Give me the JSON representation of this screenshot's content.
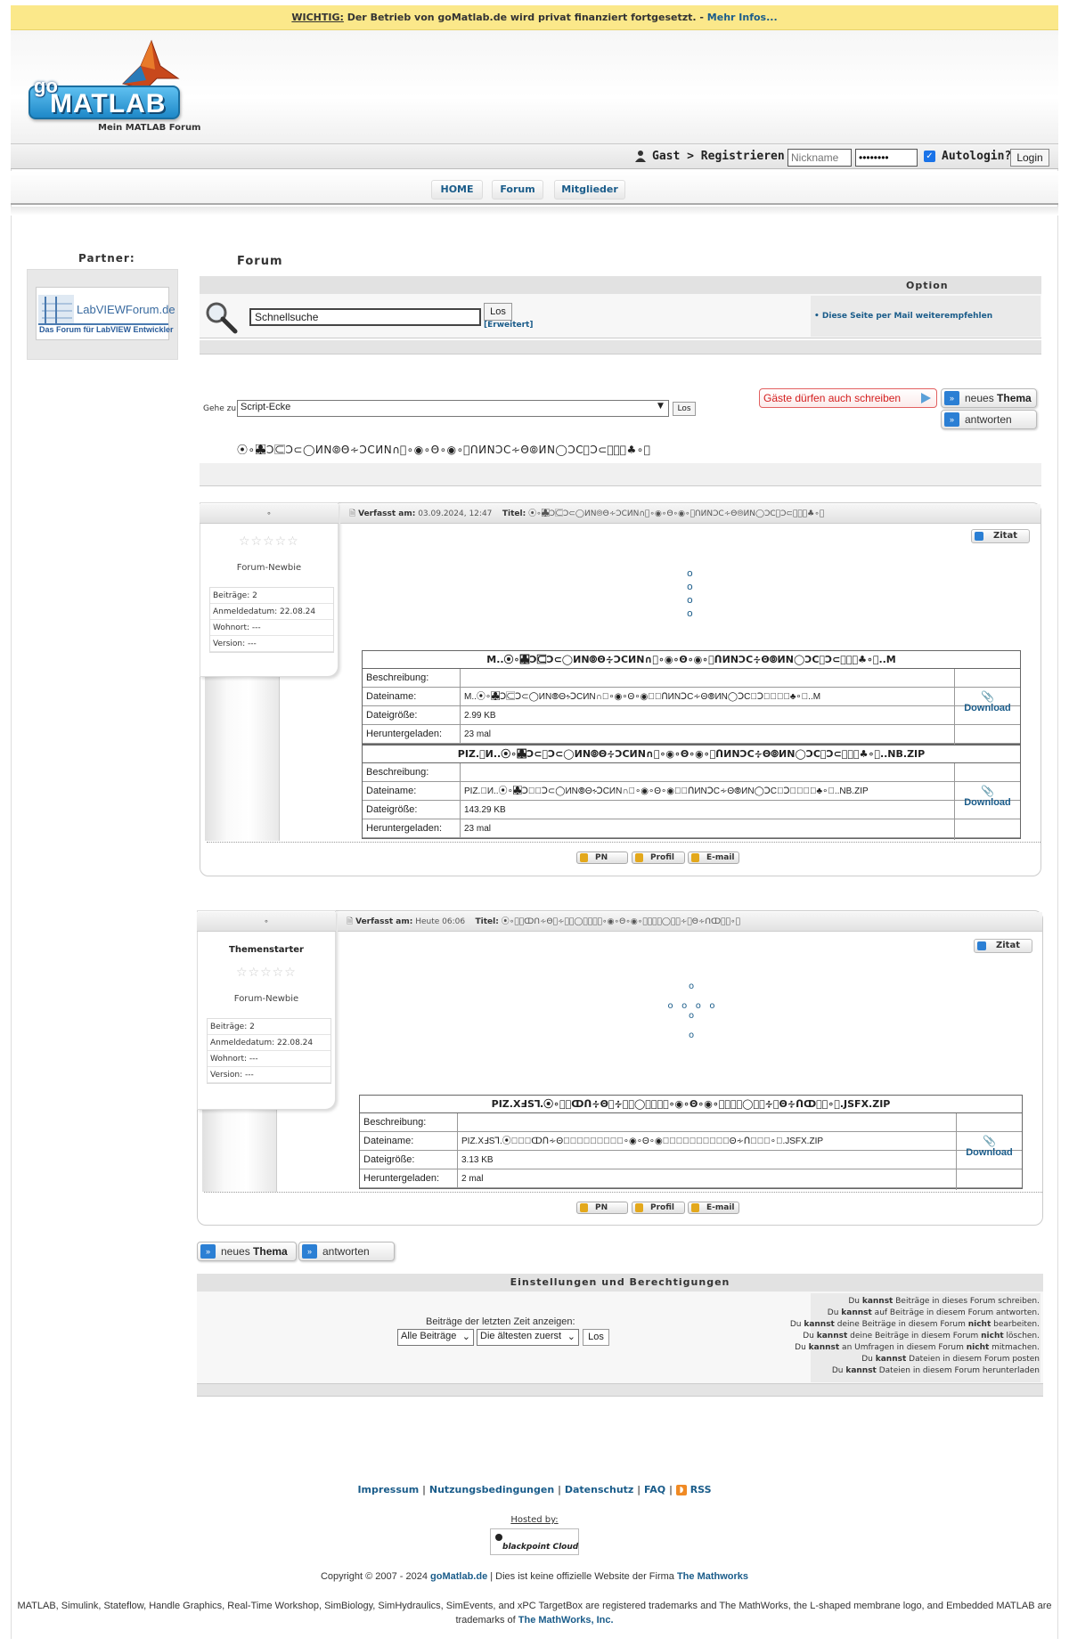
{
  "notice": {
    "prefix": "WICHTIG:",
    "text": " Der Betrieb von goMatlab.de wird privat finanziert fortgesetzt. - ",
    "link": "Mehr Infos..."
  },
  "logo": {
    "go": "go",
    "matlab": "MATLAB",
    "subtitle": "Mein MATLAB Forum"
  },
  "login": {
    "guest_text": "Gast > Registrieren",
    "nickname_placeholder": "Nickname",
    "password_value": "••••••••",
    "autologin_label": "Autologin?",
    "login_button": "Login"
  },
  "nav": {
    "home": "HOME",
    "forum": "Forum",
    "members": "Mitglieder"
  },
  "sidebar": {
    "partner_title": "Partner:",
    "partner_name": "LabVIEWForum.de",
    "partner_tagline": "Das Forum für LabVIEW Entwickler"
  },
  "forum": {
    "title": "Forum",
    "option_header": "Option",
    "search_value": "Schnellsuche",
    "search_button": "Los",
    "extended_search": "[Erweitert]",
    "mail_link": "• Diese Seite per Mail weiterempfehlen"
  },
  "jump": {
    "label": "Gehe zu:",
    "selected": "Script-Ecke",
    "button": "Los"
  },
  "actions": {
    "guests_write": "Gäste dürfen auch schreiben",
    "new_topic_prefix": "neues ",
    "new_topic_bold": "Thema",
    "reply": "antworten"
  },
  "topic_title": "⦿∘♣⃞⃞⃞Ↄ⊂⃞Ↄ⊂◯ИΝ⦾Θ∻ↃϹИΝ∩⃞∘◉∘Θ∘◉∘⃞ᑎИΝↃϹ∻Θ⦾ИΝ◯ↃϹ⃞Ↄ⊂⃞⃞⃞♣∘⦿",
  "posts": [
    {
      "author": "∘",
      "author_label": "",
      "stars": "☆☆☆☆☆",
      "rank": "Forum-Newbie",
      "info": [
        "Beiträge: 2",
        "Anmeldedatum: 22.08.24",
        "Wohnort: ---",
        "Version: ---"
      ],
      "posted_label": "Verfasst am:",
      "posted_date": "03.09.2024, 12:47",
      "title_label": "Titel:",
      "title": "⦿∘♣⃞⃞⃞Ↄ⊂⃞Ↄ⊂◯ИΝ⦾Θ∻ↃϹИΝ∩⃞∘◉∘Θ∘◉∘⃞ᑎИΝↃϹ∻Θ⦾ИΝ◯ↃϹ⃞Ↄ⊂⃞⃞⃞♣∘⦿",
      "quote": "Zitat",
      "attachments": [
        {
          "header": "M..⦿∘♣⃞⃞⃞Ↄ⊂⃞Ↄ⊂◯ИΝ⦾Θ∻ↃϹИΝ∩⃞∘◉∘Θ∘◉∘⃞ᑎИΝↃϹ∻Θ⦾ИΝ◯ↃϹ⃞Ↄ⊂⃞⃞⃞♣∘⦿..M",
          "labels": [
            "Beschreibung:",
            "Dateiname:",
            "Dateigröße:",
            "Heruntergeladen:"
          ],
          "description": "",
          "filename": "M..⦿∘♣⃞⃞⃞Ↄ⊂⃞Ↄ⊂◯ИΝ⦾Θ∻ↃϹИΝ∩⃞∘◉∘Θ∘◉∘⃞ᑎИΝↃϹ∻Θ⦾ИΝ◯ↃϹ⃞Ↄ⊂⃞⃞⃞♣∘⦿..M",
          "size": "2.99 KB",
          "downloads": "23 mal",
          "download": "Download"
        },
        {
          "header": "PIZ.⃞И..⦿∘♣⃞⃞⃞Ↄ⊂⃞Ↄ⊂◯ИΝ⦾Θ∻ↃϹИΝ∩⃞∘◉∘Θ∘◉∘⃞ᑎИΝↃϹ∻Θ⦾ИΝ◯ↃϹ⃞Ↄ⊂⃞⃞⃞♣∘⦿..NB.ZIP",
          "labels": [
            "Beschreibung:",
            "Dateiname:",
            "Dateigröße:",
            "Heruntergeladen:"
          ],
          "description": "",
          "filename": "PIZ.⃞И..⦿∘♣⃞⃞⃞Ↄ⊂⃞Ↄ⊂◯ИΝ⦾Θ∻ↃϹИΝ∩⃞∘◉∘Θ∘◉∘⃞ᑎИΝↃϹ∻Θ⦾ИΝ◯ↃϹ⃞Ↄ⊂⃞⃞⃞♣∘⦿..NB.ZIP",
          "size": "143.29 KB",
          "downloads": "23 mal",
          "download": "Download"
        }
      ],
      "buttons": {
        "pm": "PN",
        "profile": "Profil",
        "email": "E-mail"
      }
    },
    {
      "author": "∘",
      "author_label": "Themenstarter",
      "stars": "☆☆☆☆☆",
      "rank": "Forum-Newbie",
      "info": [
        "Beiträge: 2",
        "Anmeldedatum: 22.08.24",
        "Wohnort: ---",
        "Version: ---"
      ],
      "posted_label": "Verfasst am:",
      "posted_date": "Heute 06:06",
      "title_label": "Titel:",
      "title": "⦿∘⃞⃞ↀᑎ∻Θ⃞∻⃞⃞◯⃞⃞⃞⃞∘◉∘Θ∘◉∘⃞⃞⃞⃞◯⃞⃞∻⃞Θ∻ᑎↀ⃞⃞∘⦿",
      "quote": "Zitat",
      "attachments": [
        {
          "header": "PIZ.XℲSꓶ.⦿∘⃞⃞ↀᑎ∻Θ⃞∻⃞⃞◯⃞⃞⃞⃞∘◉∘Θ∘◉∘⃞⃞⃞⃞◯⃞⃞∻⃞Θ∻ᑎↀ⃞⃞∘⦿.JSFX.ZIP",
          "labels": [
            "Beschreibung:",
            "Dateiname:",
            "Dateigröße:",
            "Heruntergeladen:"
          ],
          "description": "",
          "filename": "PIZ.XℲSꓶ.⦿∘⃞⃞ↀᑎ∻Θ⃞∻⃞⃞◯⃞⃞⃞⃞∘◉∘Θ∘◉∘⃞⃞⃞⃞◯⃞⃞∻⃞Θ∻ᑎↀ⃞⃞∘⦿.JSFX.ZIP",
          "size": "3.13 KB",
          "downloads": "2 mal",
          "download": "Download"
        }
      ],
      "buttons": {
        "pm": "PN",
        "profile": "Profil",
        "email": "E-mail"
      }
    }
  ],
  "settings": {
    "header": "Einstellungen und Berechtigungen",
    "last_label": "Beiträge der letzten Zeit anzeigen:",
    "period": "Alle Beiträge",
    "order": "Die ältesten zuerst",
    "button": "Los",
    "permissions": [
      {
        "pre": "Du ",
        "b": "kannst",
        "post": " Beiträge in dieses Forum schreiben."
      },
      {
        "pre": "Du ",
        "b": "kannst",
        "post": " auf Beiträge in diesem Forum antworten."
      },
      {
        "pre": "Du ",
        "b": "kannst",
        "post": " deine Beiträge in diesem Forum ",
        "b2": "nicht",
        "post2": " bearbeiten."
      },
      {
        "pre": "Du ",
        "b": "kannst",
        "post": " deine Beiträge in diesem Forum ",
        "b2": "nicht",
        "post2": " löschen."
      },
      {
        "pre": "Du ",
        "b": "kannst",
        "post": " an Umfragen in diesem Forum ",
        "b2": "nicht",
        "post2": " mitmachen."
      },
      {
        "pre": "Du ",
        "b": "kannst",
        "post": " Dateien in diesem Forum posten"
      },
      {
        "pre": "Du ",
        "b": "kannst",
        "post": " Dateien in diesem Forum herunterladen"
      }
    ]
  },
  "footer": {
    "links": [
      "Impressum",
      "Nutzungsbedingungen",
      "Datenschutz",
      "FAQ",
      "RSS"
    ],
    "hosted_by": "Hosted by:",
    "host_name": "blackpoint Cloud",
    "copyright_pre": "Copyright © 2007 - 2024 ",
    "copyright_site": "goMatlab.de",
    "copyright_mid": " | Dies ist keine offizielle Website der Firma ",
    "copyright_company": "The Mathworks",
    "trademark": "MATLAB, Simulink, Stateflow, Handle Graphics, Real-Time Workshop, SimBiology, SimHydraulics, SimEvents, and xPC TargetBox are registered trademarks and The MathWorks, the L-shaped membrane logo, and Embedded MATLAB are trademarks of ",
    "trademark_company": "The MathWorks, Inc."
  },
  "colors": {
    "accent": "#1a5c8a",
    "notice_bg": "#fbe88a",
    "guest_red": "#d42020"
  }
}
